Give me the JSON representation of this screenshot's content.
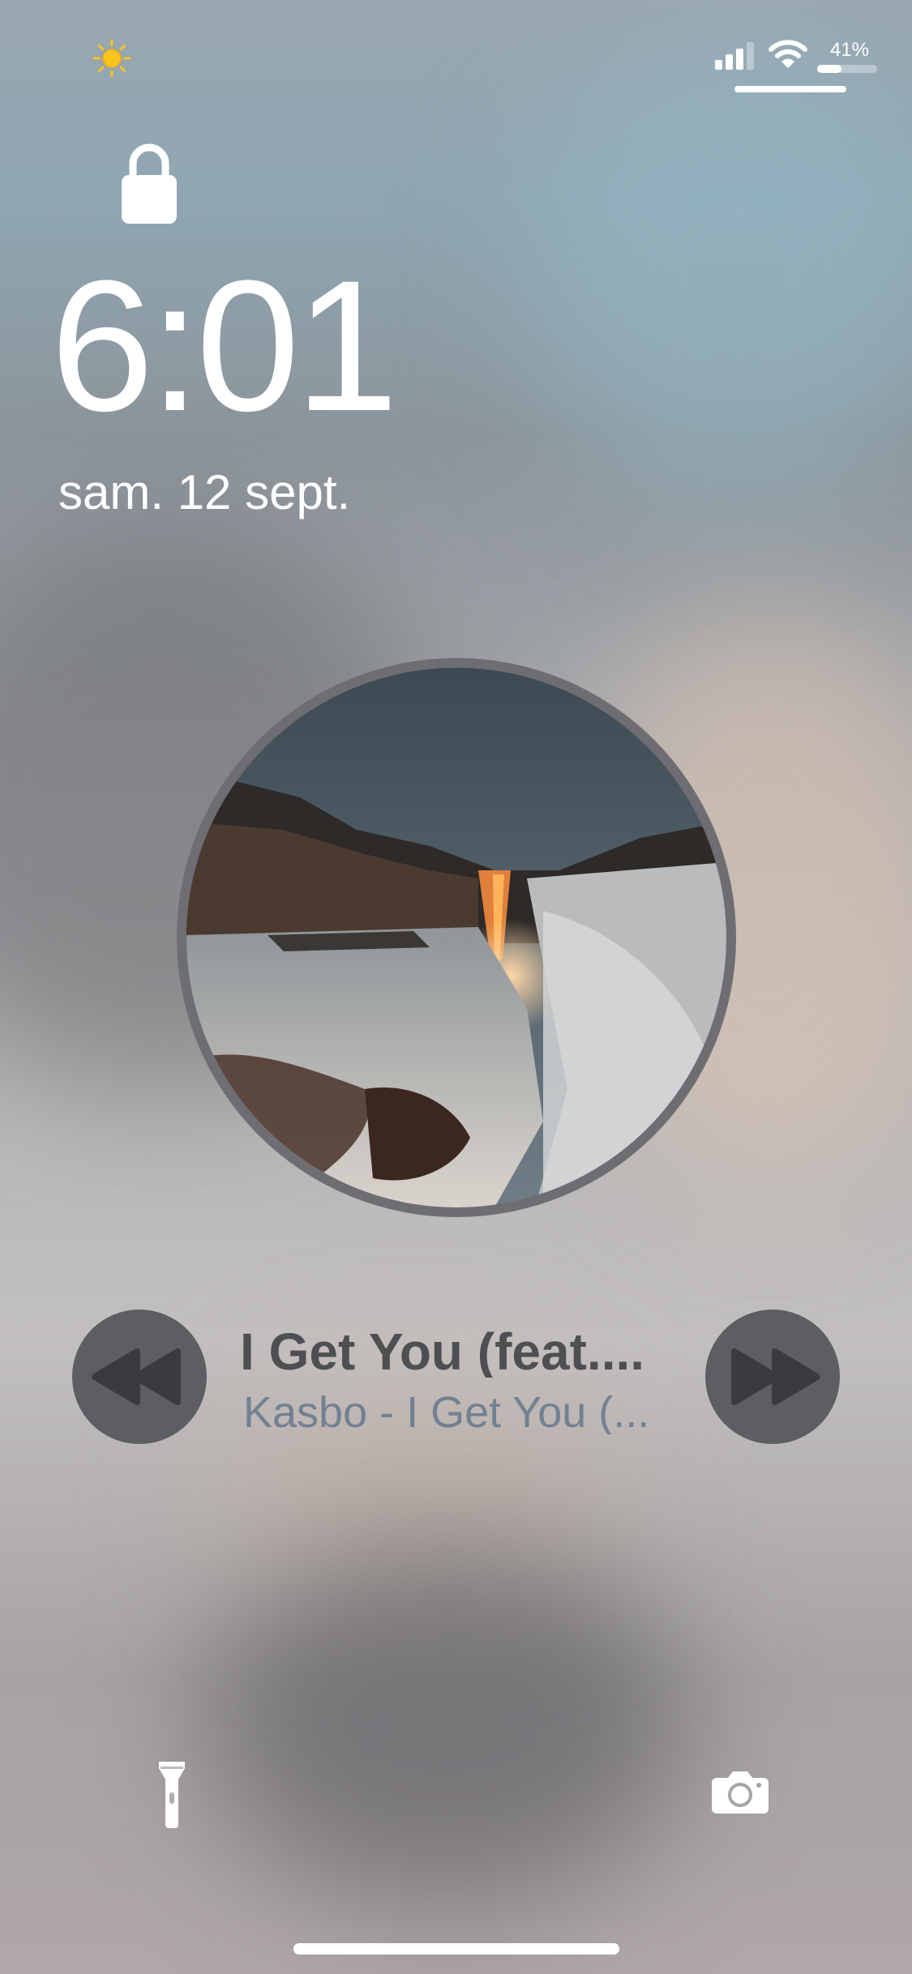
{
  "status_bar": {
    "weather_icon": "sun-icon",
    "signal_icon": "cellular-signal-icon",
    "signal_bars_filled": 3,
    "signal_bars_total": 4,
    "wifi_icon": "wifi-icon",
    "battery_percent": "41%",
    "battery_level": 0.41
  },
  "lock_screen": {
    "lock_icon": "padlock-icon",
    "time": "6:01",
    "date": "sam. 12 sept."
  },
  "now_playing": {
    "artwork": "waterfall-landscape-artwork",
    "title": "I Get You (feat....",
    "subtitle": "Kasbo - I Get You (...",
    "previous_icon": "rewind-icon",
    "next_icon": "fast-forward-icon"
  },
  "bottom_bar": {
    "flashlight_icon": "flashlight-icon",
    "camera_icon": "camera-icon"
  },
  "colors": {
    "title": "#4e4f53",
    "subtitle": "#728192",
    "button": "#5d5e62",
    "weather": "#f6c41e"
  }
}
